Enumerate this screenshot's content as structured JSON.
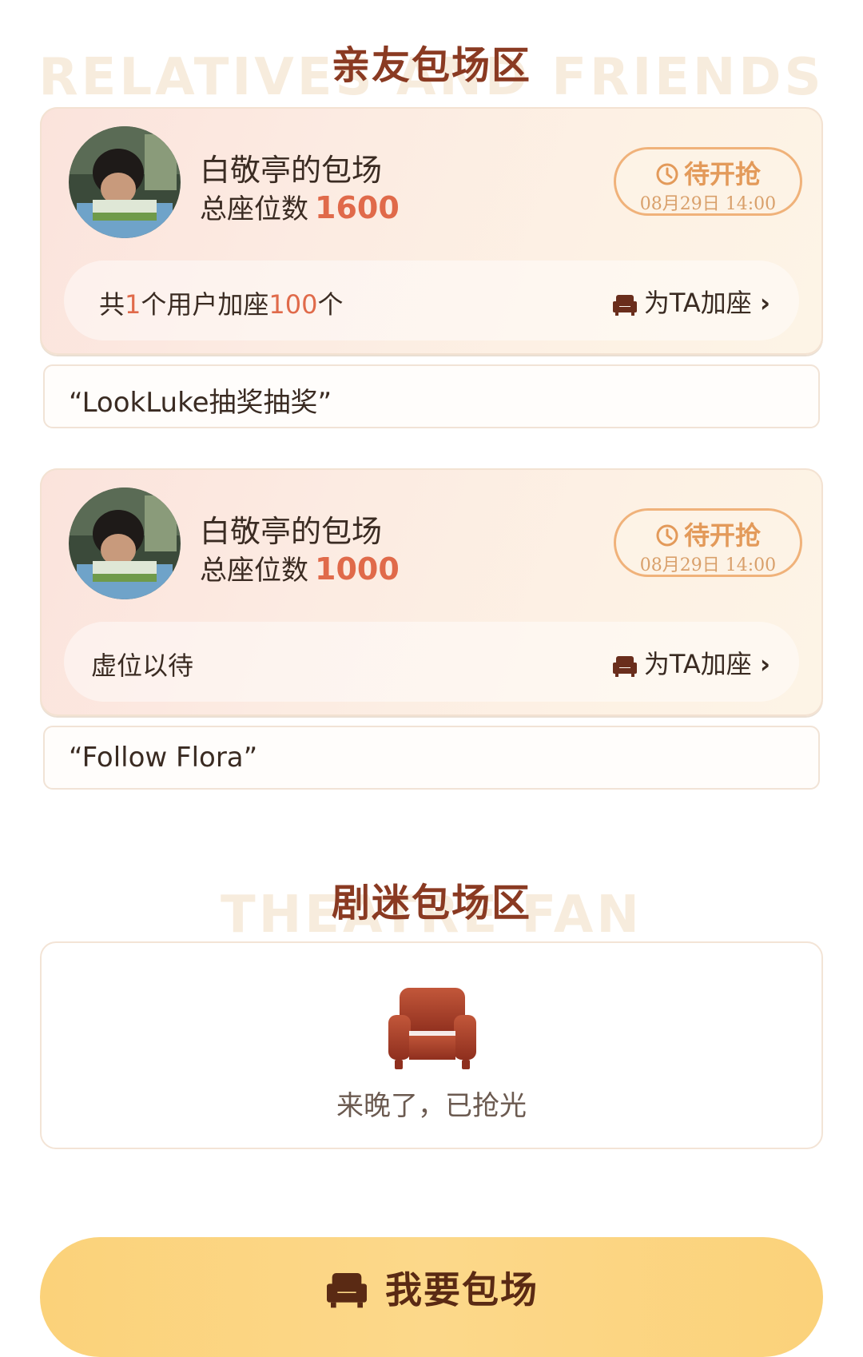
{
  "relatives_section": {
    "title": "亲友包场区",
    "bg_text": "RELATIVES AND FRIENDS"
  },
  "bookings": [
    {
      "host": "白敬亭的包场",
      "seats_label": "总座位数",
      "seats": "1600",
      "status": "待开抢",
      "status_time": "08月29日 14:00",
      "add_prefix": "共",
      "add_users": "1",
      "add_middle": "个用户加座",
      "add_count": "100",
      "add_suffix": "个",
      "add_link": "为TA加座",
      "quote": "“LookLuke抽奖抽奖”"
    },
    {
      "host": "白敬亭的包场",
      "seats_label": "总座位数",
      "seats": "1000",
      "status": "待开抢",
      "status_time": "08月29日 14:00",
      "add_text": "虚位以待",
      "add_link": "为TA加座",
      "quote": "“Follow Flora”"
    }
  ],
  "fan_section": {
    "title": "剧迷包场区",
    "bg_text": "THEATRE FAN",
    "empty_text": "来晚了，已抢光"
  },
  "cta": {
    "label": "我要包场"
  },
  "colors": {
    "accent": "#e06a4a",
    "brown": "#8a3a22",
    "pill_border": "#f0b27a",
    "cta": "#fbd27a"
  },
  "icons": [
    "clock-icon",
    "sofa-icon",
    "chevron-right-icon"
  ]
}
